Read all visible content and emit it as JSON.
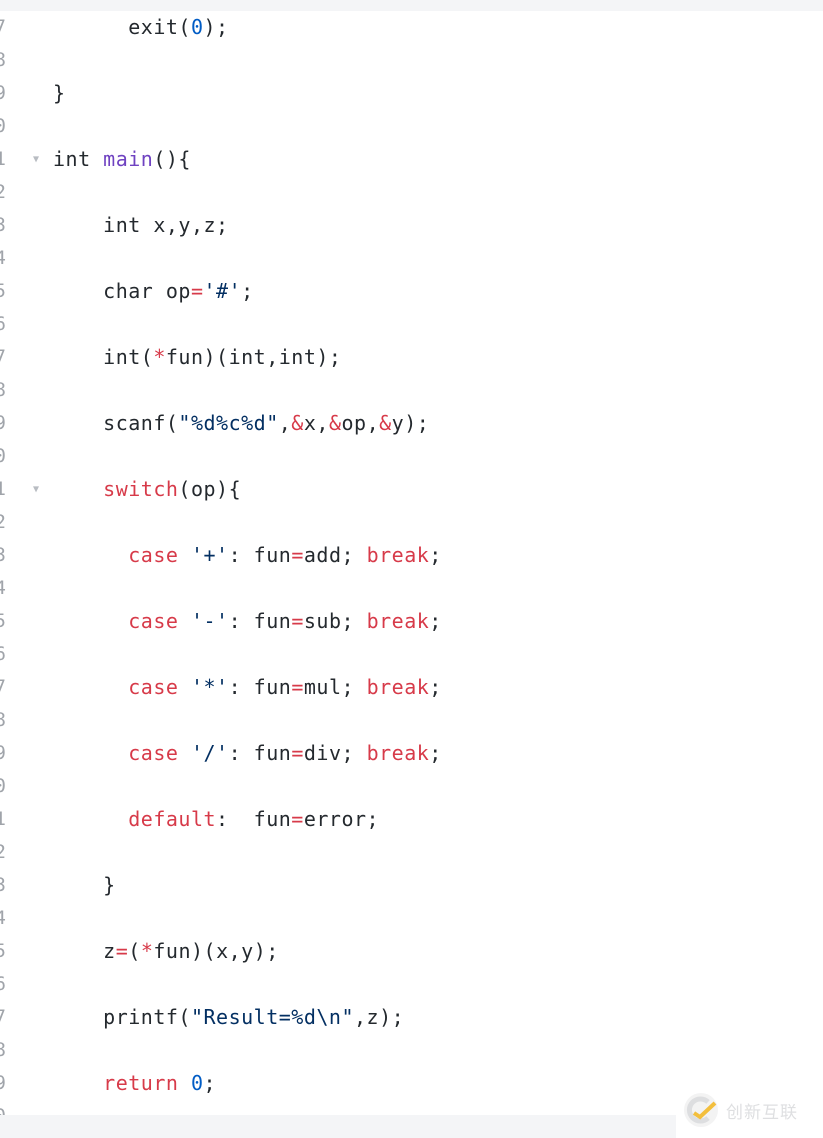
{
  "colors": {
    "keyword": "#d73a49",
    "function": "#6f42c1",
    "number": "#005cc5",
    "string": "#032f62",
    "text": "#24292e"
  },
  "watermark": {
    "text": "创新互联",
    "logo": "chuangxin-logo-icon"
  },
  "lines": [
    {
      "num": "7",
      "fold": false,
      "tokens": [
        [
          "pl",
          "      exit("
        ],
        [
          "num",
          "0"
        ],
        [
          "pl",
          ");"
        ]
      ]
    },
    {
      "num": "8",
      "fold": false,
      "tokens": []
    },
    {
      "num": "9",
      "fold": false,
      "tokens": [
        [
          "pl",
          "}"
        ]
      ]
    },
    {
      "num": "0",
      "fold": false,
      "tokens": []
    },
    {
      "num": "1",
      "fold": true,
      "tokens": [
        [
          "pl",
          "int "
        ],
        [
          "fn",
          "main"
        ],
        [
          "pl",
          "(){"
        ]
      ]
    },
    {
      "num": "2",
      "fold": false,
      "tokens": []
    },
    {
      "num": "3",
      "fold": false,
      "tokens": [
        [
          "pl",
          "    int x,y,z; "
        ]
      ]
    },
    {
      "num": "4",
      "fold": false,
      "tokens": []
    },
    {
      "num": "5",
      "fold": false,
      "tokens": [
        [
          "pl",
          "    char op"
        ],
        [
          "op",
          "="
        ],
        [
          "str",
          "'#'"
        ],
        [
          "pl",
          ";  "
        ]
      ]
    },
    {
      "num": "6",
      "fold": false,
      "tokens": []
    },
    {
      "num": "7",
      "fold": false,
      "tokens": [
        [
          "pl",
          "    int("
        ],
        [
          "op",
          "*"
        ],
        [
          "pl",
          "fun)(int,int);"
        ]
      ]
    },
    {
      "num": "8",
      "fold": false,
      "tokens": []
    },
    {
      "num": "9",
      "fold": false,
      "tokens": [
        [
          "pl",
          "    scanf("
        ],
        [
          "str",
          "\"%d%c%d\""
        ],
        [
          "pl",
          ","
        ],
        [
          "op",
          "&"
        ],
        [
          "pl",
          "x,"
        ],
        [
          "op",
          "&"
        ],
        [
          "pl",
          "op,"
        ],
        [
          "op",
          "&"
        ],
        [
          "pl",
          "y);"
        ]
      ]
    },
    {
      "num": "0",
      "fold": false,
      "tokens": []
    },
    {
      "num": "1",
      "fold": true,
      "tokens": [
        [
          "pl",
          "    "
        ],
        [
          "kw",
          "switch"
        ],
        [
          "pl",
          "(op){"
        ]
      ]
    },
    {
      "num": "2",
      "fold": false,
      "tokens": []
    },
    {
      "num": "3",
      "fold": false,
      "tokens": [
        [
          "pl",
          "      "
        ],
        [
          "kw",
          "case"
        ],
        [
          "pl",
          " "
        ],
        [
          "str",
          "'+'"
        ],
        [
          "pl",
          ": fun"
        ],
        [
          "op",
          "="
        ],
        [
          "pl",
          "add; "
        ],
        [
          "kw",
          "break"
        ],
        [
          "pl",
          ";"
        ]
      ]
    },
    {
      "num": "4",
      "fold": false,
      "tokens": []
    },
    {
      "num": "5",
      "fold": false,
      "tokens": [
        [
          "pl",
          "      "
        ],
        [
          "kw",
          "case"
        ],
        [
          "pl",
          " "
        ],
        [
          "str",
          "'-'"
        ],
        [
          "pl",
          ": fun"
        ],
        [
          "op",
          "="
        ],
        [
          "pl",
          "sub; "
        ],
        [
          "kw",
          "break"
        ],
        [
          "pl",
          ";"
        ]
      ]
    },
    {
      "num": "6",
      "fold": false,
      "tokens": []
    },
    {
      "num": "7",
      "fold": false,
      "tokens": [
        [
          "pl",
          "      "
        ],
        [
          "kw",
          "case"
        ],
        [
          "pl",
          " "
        ],
        [
          "str",
          "'*'"
        ],
        [
          "pl",
          ": fun"
        ],
        [
          "op",
          "="
        ],
        [
          "pl",
          "mul; "
        ],
        [
          "kw",
          "break"
        ],
        [
          "pl",
          ";"
        ]
      ]
    },
    {
      "num": "8",
      "fold": false,
      "tokens": []
    },
    {
      "num": "9",
      "fold": false,
      "tokens": [
        [
          "pl",
          "      "
        ],
        [
          "kw",
          "case"
        ],
        [
          "pl",
          " "
        ],
        [
          "str",
          "'/'"
        ],
        [
          "pl",
          ": fun"
        ],
        [
          "op",
          "="
        ],
        [
          "pl",
          "div; "
        ],
        [
          "kw",
          "break"
        ],
        [
          "pl",
          ";"
        ]
      ]
    },
    {
      "num": "0",
      "fold": false,
      "tokens": []
    },
    {
      "num": "1",
      "fold": false,
      "tokens": [
        [
          "pl",
          "      "
        ],
        [
          "kw",
          "default"
        ],
        [
          "pl",
          ":  fun"
        ],
        [
          "op",
          "="
        ],
        [
          "pl",
          "error;"
        ]
      ]
    },
    {
      "num": "2",
      "fold": false,
      "tokens": []
    },
    {
      "num": "3",
      "fold": false,
      "tokens": [
        [
          "pl",
          "    }"
        ]
      ]
    },
    {
      "num": "4",
      "fold": false,
      "tokens": []
    },
    {
      "num": "5",
      "fold": false,
      "tokens": [
        [
          "pl",
          "    z"
        ],
        [
          "op",
          "="
        ],
        [
          "pl",
          "("
        ],
        [
          "op",
          "*"
        ],
        [
          "pl",
          "fun)(x,y);"
        ]
      ]
    },
    {
      "num": "6",
      "fold": false,
      "tokens": []
    },
    {
      "num": "7",
      "fold": false,
      "tokens": [
        [
          "pl",
          "    printf("
        ],
        [
          "str",
          "\"Result=%d\\n\""
        ],
        [
          "pl",
          ",z);"
        ]
      ]
    },
    {
      "num": "8",
      "fold": false,
      "tokens": []
    },
    {
      "num": "9",
      "fold": false,
      "tokens": [
        [
          "pl",
          "    "
        ],
        [
          "kw",
          "return"
        ],
        [
          "pl",
          " "
        ],
        [
          "num",
          "0"
        ],
        [
          "pl",
          ";"
        ]
      ]
    },
    {
      "num": "0",
      "fold": false,
      "tokens": []
    }
  ]
}
